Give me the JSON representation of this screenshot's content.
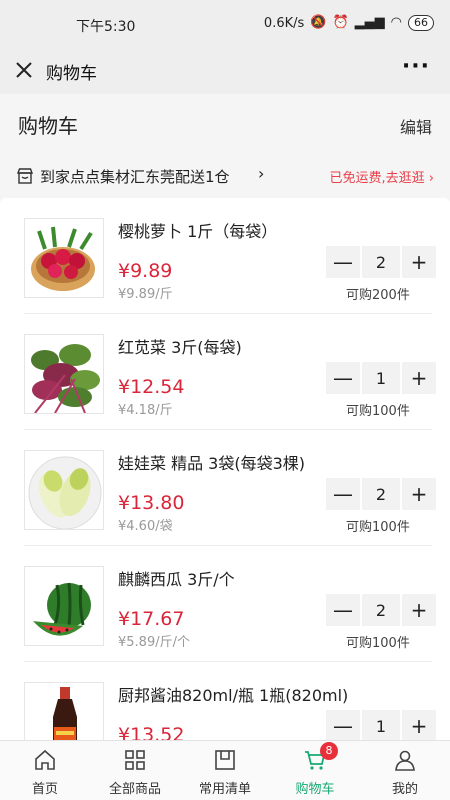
{
  "status_bar": {
    "time": "下午5:30",
    "network_speed": "0.6K/s",
    "battery": "66"
  },
  "nav": {
    "title": "购物车",
    "more_label": "···"
  },
  "page": {
    "title": "购物车",
    "edit_label": "编辑"
  },
  "store": {
    "name": "到家点点集材汇东莞配送1仓",
    "shipping_note": "已免运费,去逛逛 ›"
  },
  "cart": {
    "minus_label": "—",
    "plus_label": "+",
    "items": [
      {
        "name": "樱桃萝卜 1斤（每袋）",
        "price": "¥9.89",
        "unit_price": "¥9.89/斤",
        "quantity": "2",
        "limit": "可购200件"
      },
      {
        "name": "红苋菜 3斤(每袋)",
        "price": "¥12.54",
        "unit_price": "¥4.18/斤",
        "quantity": "1",
        "limit": "可购100件"
      },
      {
        "name": "娃娃菜 精品 3袋(每袋3棵)",
        "price": "¥13.80",
        "unit_price": "¥4.60/袋",
        "quantity": "2",
        "limit": "可购100件"
      },
      {
        "name": "麒麟西瓜 3斤/个",
        "price": "¥17.67",
        "unit_price": "¥5.89/斤/个",
        "quantity": "2",
        "limit": "可购100件"
      },
      {
        "name": "厨邦酱油820ml/瓶 1瓶(820ml)",
        "price": "¥13.52",
        "unit_price": "",
        "quantity": "1",
        "limit": ""
      }
    ]
  },
  "tabbar": {
    "tabs": [
      {
        "label": "首页",
        "icon": "home-icon"
      },
      {
        "label": "全部商品",
        "icon": "grid-icon"
      },
      {
        "label": "常用清单",
        "icon": "list-icon"
      },
      {
        "label": "购物车",
        "icon": "cart-icon",
        "badge": "8"
      },
      {
        "label": "我的",
        "icon": "user-icon"
      }
    ]
  },
  "colors": {
    "price_red": "#d9263a",
    "accent_green": "#19a974",
    "badge_red": "#e8303b"
  }
}
